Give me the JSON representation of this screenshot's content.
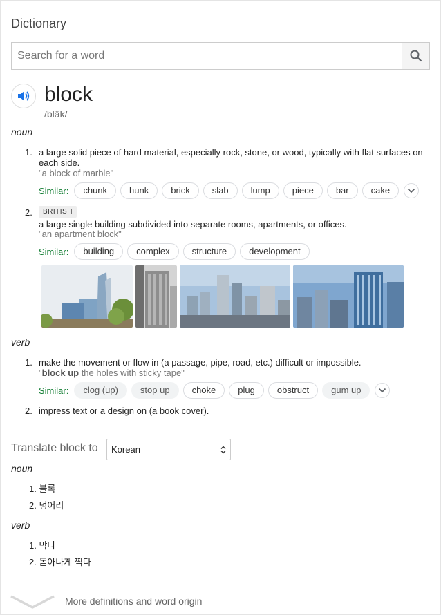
{
  "header": {
    "title": "Dictionary"
  },
  "search": {
    "placeholder": "Search for a word",
    "icon": "search-icon"
  },
  "entry": {
    "word": "block",
    "phonetic": "/bläk/"
  },
  "noun": {
    "label": "noun",
    "senses": [
      {
        "num": "1.",
        "definition": "a large solid piece of hard material, especially rock, stone, or wood, typically with flat surfaces on each side.",
        "example": "\"a block of marble\"",
        "similar_label": "Similar:",
        "similar": [
          "chunk",
          "hunk",
          "brick",
          "slab",
          "lump",
          "piece",
          "bar",
          "cake"
        ]
      },
      {
        "num": "2.",
        "tag": "BRITISH",
        "definition": "a large single building subdivided into separate rooms, apartments, or offices.",
        "example": "\"an apartment block\"",
        "similar_label": "Similar:",
        "similar": [
          "building",
          "complex",
          "structure",
          "development"
        ]
      }
    ]
  },
  "verb": {
    "label": "verb",
    "senses": [
      {
        "num": "1.",
        "definition": "make the movement or flow in (a passage, pipe, road, etc.) difficult or impossible.",
        "example_open": "\"",
        "example_bold": "block up",
        "example_rest": " the holes with sticky tape\"",
        "similar_label": "Similar:",
        "similar": [
          "clog (up)",
          "stop up",
          "choke",
          "plug",
          "obstruct",
          "gum up"
        ]
      },
      {
        "num": "2.",
        "definition": "impress text or a design on (a book cover)."
      }
    ]
  },
  "translate": {
    "label": "Translate block to",
    "language": "Korean",
    "noun_label": "noun",
    "noun_items": [
      "1. 블록",
      "2. 덩어리"
    ],
    "verb_label": "verb",
    "verb_items": [
      "1. 막다",
      "2. 돋아나게 찍다"
    ]
  },
  "footer": {
    "more_label": "More definitions and word origin"
  },
  "colors": {
    "accent": "#1a73e8",
    "similar": "#188038"
  }
}
